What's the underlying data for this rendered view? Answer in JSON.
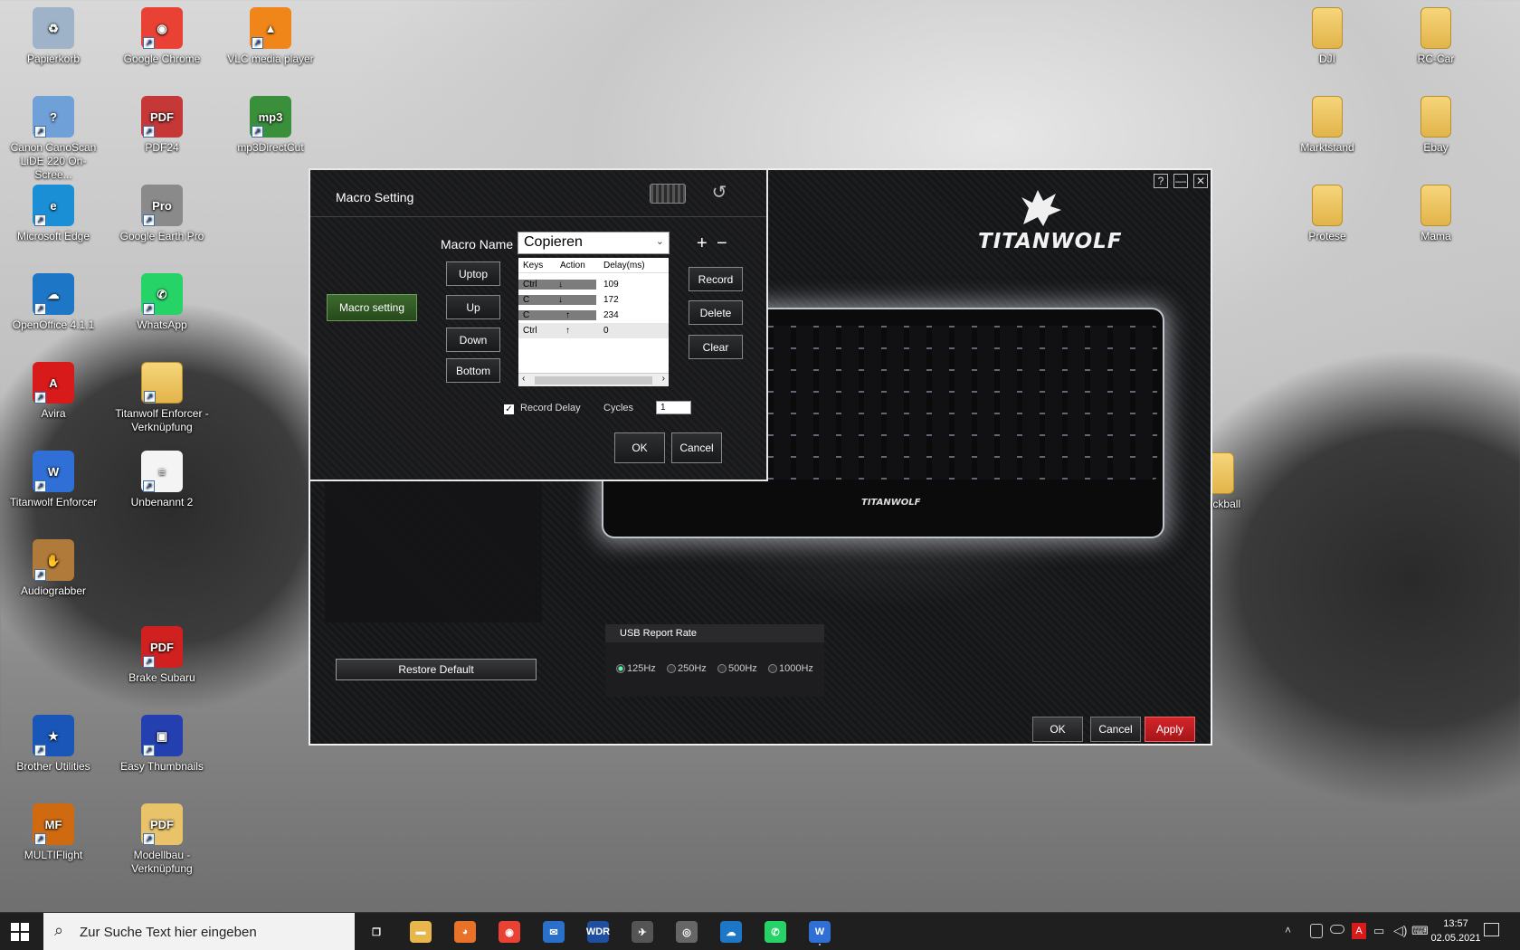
{
  "desktop": {
    "icons_left": [
      {
        "label": "Papierkorb",
        "icon": "recycle-bin-icon",
        "glyph": "♻",
        "color": "#9fb3c8"
      },
      {
        "label": "Google Chrome",
        "icon": "chrome-icon",
        "glyph": "◉",
        "color": "#e94235"
      },
      {
        "label": "VLC media player",
        "icon": "vlc-icon",
        "glyph": "▲",
        "color": "#f08519"
      },
      {
        "label": "Canon CanoScan LiDE 220 On-Scree...",
        "icon": "canon-help-icon",
        "glyph": "?",
        "color": "#6fa0d8"
      },
      {
        "label": "PDF24",
        "icon": "pdf24-icon",
        "glyph": "PDF",
        "color": "#c63737"
      },
      {
        "label": "mp3DirectCut",
        "icon": "mp3directcut-icon",
        "glyph": "mp3",
        "color": "#3a8f3a"
      },
      {
        "label": "Microsoft Edge",
        "icon": "edge-icon",
        "glyph": "e",
        "color": "#1b8fd6"
      },
      {
        "label": "Google Earth Pro",
        "icon": "google-earth-icon",
        "glyph": "Pro",
        "color": "#8a8a8a"
      },
      {
        "label": "OpenOffice 4.1.1",
        "icon": "openoffice-icon",
        "glyph": "☁",
        "color": "#1e77c6"
      },
      {
        "label": "WhatsApp",
        "icon": "whatsapp-icon",
        "glyph": "✆",
        "color": "#25d366"
      },
      {
        "label": "Avira",
        "icon": "avira-icon",
        "glyph": "A",
        "color": "#d91a1a"
      },
      {
        "label": "Titanwolf Enforcer - Verknüpfung",
        "icon": "folder-icon",
        "glyph": "",
        "color": "#f1cf6e"
      },
      {
        "label": "Titanwolf Enforcer",
        "icon": "titanwolf-icon",
        "glyph": "W",
        "color": "#2f6fd6"
      },
      {
        "label": "Unbenannt 2",
        "icon": "document-icon",
        "glyph": "≡",
        "color": "#f4f4f4"
      },
      {
        "label": "Audiograbber",
        "icon": "audiograbber-icon",
        "glyph": "✋",
        "color": "#b07a3a"
      },
      {
        "label": "Brake Subaru",
        "icon": "pdf-icon",
        "glyph": "PDF",
        "color": "#d02020"
      },
      {
        "label": "Brother Utilities",
        "icon": "brother-utilities-icon",
        "glyph": "★",
        "color": "#1a56b8"
      },
      {
        "label": "Easy Thumbnails",
        "icon": "easy-thumbnails-icon",
        "glyph": "▣",
        "color": "#2440b0"
      },
      {
        "label": "MULTIFlight",
        "icon": "multiflight-icon",
        "glyph": "MF",
        "color": "#d06a10"
      },
      {
        "label": "Modellbau - Verknüpfung",
        "icon": "pdf-shortcut-icon",
        "glyph": "PDF",
        "color": "#e9c36a"
      }
    ],
    "icons_right": [
      {
        "label": "DJI",
        "icon": "folder-icon"
      },
      {
        "label": "RC-Car",
        "icon": "folder-icon"
      },
      {
        "label": "Marktstand",
        "icon": "folder-icon"
      },
      {
        "label": "Ebay",
        "icon": "folder-icon"
      },
      {
        "label": "Protese",
        "icon": "folder-icon"
      },
      {
        "label": "Mama",
        "icon": "folder-icon"
      },
      {
        "label": "Trackball",
        "icon": "folder-icon"
      }
    ]
  },
  "app": {
    "brand": "TITANWOLF",
    "keyboard_brand": "TITANWOLF",
    "help_label": "?",
    "minimize_label": "—",
    "close_label": "✕",
    "restore_default": "Restore Default",
    "usb_report_rate": {
      "title": "USB Report Rate",
      "options": [
        "125Hz",
        "250Hz",
        "500Hz",
        "1000Hz"
      ],
      "selected": "125Hz"
    },
    "footer": {
      "ok": "OK",
      "cancel": "Cancel",
      "apply": "Apply"
    }
  },
  "macro_dialog": {
    "title": "Macro Setting",
    "sidebar_button": "Macro setting",
    "macro_name_label": "Macro Name",
    "macro_name_value": "Copieren",
    "add_label": "+",
    "remove_label": "−",
    "move_buttons": {
      "uptop": "Uptop",
      "up": "Up",
      "down": "Down",
      "bottom": "Bottom"
    },
    "table": {
      "headers": [
        "Keys",
        "Action",
        "Delay(ms)"
      ],
      "rows": [
        {
          "key": "Ctrl",
          "action": "↓",
          "delay": "109"
        },
        {
          "key": "C",
          "action": "↓",
          "delay": "172"
        },
        {
          "key": "C",
          "action": "↑",
          "delay": "234"
        },
        {
          "key": "Ctrl",
          "action": "↑",
          "delay": "0"
        }
      ]
    },
    "actions": {
      "record": "Record",
      "delete": "Delete",
      "clear": "Clear"
    },
    "record_delay_label": "Record Delay",
    "record_delay_checked": true,
    "cycles_label": "Cycles",
    "cycles_value": "1",
    "ok": "OK",
    "cancel": "Cancel"
  },
  "taskbar": {
    "search_placeholder": "Zur Suche Text hier eingeben",
    "time": "13:57",
    "date": "02.05.2021",
    "pinned": [
      {
        "icon": "task-view-icon",
        "glyph": "❐",
        "color": "#1f1f1f"
      },
      {
        "icon": "file-explorer-icon",
        "glyph": "▬",
        "color": "#e8b64a"
      },
      {
        "icon": "firefox-icon",
        "glyph": "◕",
        "color": "#e8722a"
      },
      {
        "icon": "chrome-icon",
        "glyph": "◉",
        "color": "#e94235"
      },
      {
        "icon": "thunderbird-icon",
        "glyph": "✉",
        "color": "#2a6fc9"
      },
      {
        "icon": "wdr-radio-icon",
        "glyph": "WDR",
        "color": "#1f4fa0"
      },
      {
        "icon": "satellite-icon",
        "glyph": "✈",
        "color": "#555"
      },
      {
        "icon": "cassette-icon",
        "glyph": "◎",
        "color": "#666"
      },
      {
        "icon": "openoffice-icon",
        "glyph": "☁",
        "color": "#1e77c6"
      },
      {
        "icon": "whatsapp-icon",
        "glyph": "✆",
        "color": "#25d366"
      },
      {
        "icon": "titanwolf-icon",
        "glyph": "W",
        "color": "#2f6fd6"
      }
    ]
  }
}
